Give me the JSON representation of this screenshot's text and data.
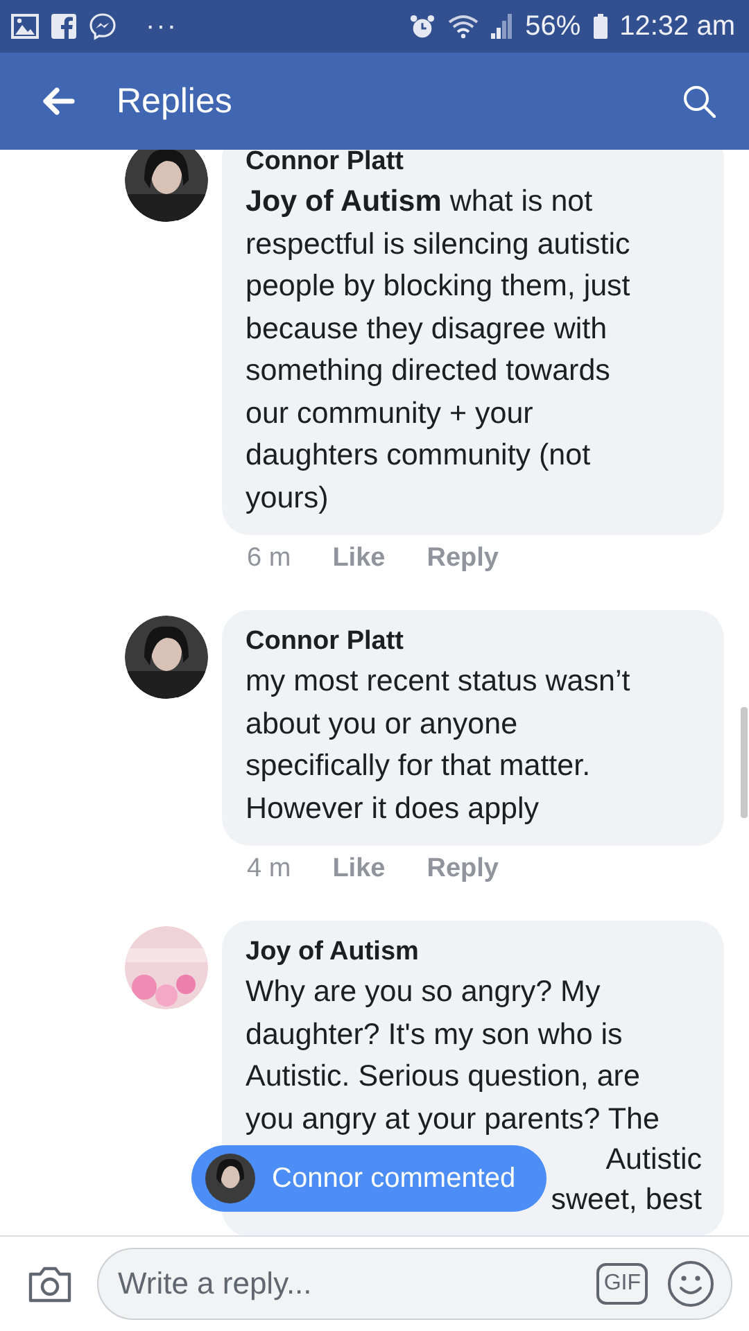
{
  "status_bar": {
    "more": "···",
    "battery": "56%",
    "time": "12:32 am"
  },
  "header": {
    "title": "Replies"
  },
  "comments": [
    {
      "author": "Connor Platt",
      "lines": [
        "**Joy of Autism**  what is not",
        "respectful is silencing autistic",
        "people by blocking them, just",
        "because they disagree with",
        "something directed towards",
        "our community + your",
        "daughters community (not",
        "yours)"
      ],
      "time": "6 m",
      "actions": [
        "Like",
        "Reply"
      ]
    },
    {
      "author": "Connor Platt",
      "lines": [
        "my most recent status wasn’t",
        "about you or anyone",
        "specifically for that matter.",
        "However it does apply"
      ],
      "time": "4 m",
      "actions": [
        "Like",
        "Reply"
      ]
    },
    {
      "author": "Joy of Autism",
      "lines": [
        "Why are you so angry? My",
        "daughter? It's my son who is",
        "Autistic. Serious question, are",
        "you angry at your parents? The"
      ],
      "cut_lines": [
        "Autistic",
        "sweet, best"
      ]
    }
  ],
  "toast": {
    "label": "Connor commented"
  },
  "composer": {
    "placeholder": "Write a reply...",
    "gif": "GIF"
  }
}
